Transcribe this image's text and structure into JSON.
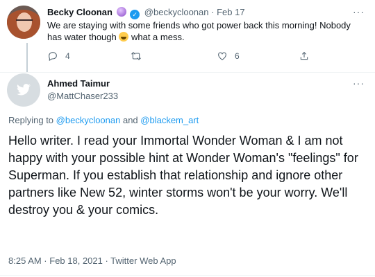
{
  "parent_tweet": {
    "author_name": "Becky Cloonan",
    "author_handle": "@beckycloonan",
    "separator": "·",
    "date": "Feb 17",
    "text_before_emoji": "We are staying with some friends who got power back this morning! Nobody has water though ",
    "text_after_emoji": " what a mess.",
    "reply_count": "4",
    "like_count": "6"
  },
  "reply_tweet": {
    "author_name": "Ahmed Taimur",
    "author_handle": "@MattChaser233",
    "replying_prefix": "Replying to ",
    "mention_1": "@beckycloonan",
    "and_word": " and ",
    "mention_2": "@blackem_art",
    "text": "Hello writer. I read your Immortal Wonder Woman & I am not happy with your possible hint at Wonder Woman's \"feelings\" for Superman. If you establish that relationship and ignore other partners like New 52, winter storms won't be your worry. We'll destroy you & your comics.",
    "timestamp": "8:25 AM · Feb 18, 2021 · Twitter Web App"
  },
  "more_label": "···",
  "colors": {
    "accent": "#1d9bf0",
    "secondary_text": "#536471",
    "primary_text": "#0f1419"
  },
  "icons": [
    "crystal-ball-emoji-icon",
    "verified-badge-icon",
    "face-with-tears-of-joy-emoji-icon",
    "reply-icon",
    "retweet-icon",
    "like-icon",
    "share-icon",
    "more-icon",
    "twitter-bird-icon"
  ]
}
